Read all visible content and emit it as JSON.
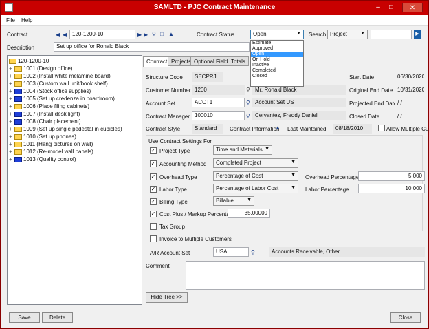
{
  "window": {
    "title": "SAMLTD - PJC Contract Maintenance"
  },
  "menu": {
    "file": "File",
    "help": "Help"
  },
  "header": {
    "contract_label": "Contract",
    "contract_value": "120-1200-10",
    "contract_status_label": "Contract Status",
    "contract_status_value": "Open",
    "search_label": "Search",
    "search_mode": "Project",
    "search_value": "",
    "description_label": "Description",
    "description_value": "Set up office for Ronald Black"
  },
  "status_options": [
    "Estimate",
    "Approved",
    "Open",
    "On Hold",
    "Inactive",
    "Completed",
    "Closed"
  ],
  "tree": {
    "root": "120-1200-10",
    "items": [
      {
        "label": "1001 (Design office)",
        "color": "yellow"
      },
      {
        "label": "1002 (Install white melamine board)",
        "color": "yellow"
      },
      {
        "label": "1003 (Custom wall unit/book shelf)",
        "color": "yellow"
      },
      {
        "label": "1004 (Stock office supplies)",
        "color": "blue"
      },
      {
        "label": "1005 (Set up credenza in boardroom)",
        "color": "blue"
      },
      {
        "label": "1006 (Place filing cabinets)",
        "color": "yellow"
      },
      {
        "label": "1007 (Install desk light)",
        "color": "blue"
      },
      {
        "label": "1008 (Chair placement)",
        "color": "blue"
      },
      {
        "label": "1009 (Set up single pedestal in cubicles)",
        "color": "yellow"
      },
      {
        "label": "1010 (Set up phones)",
        "color": "yellow"
      },
      {
        "label": "1011 (Hang pictures on wall)",
        "color": "yellow"
      },
      {
        "label": "1012 (Re-model wall panels)",
        "color": "yellow"
      },
      {
        "label": "1013 (Quality control)",
        "color": "blue"
      }
    ]
  },
  "tabs": [
    "Contract",
    "Projects",
    "Optional Fields",
    "Totals"
  ],
  "form": {
    "structure_code_label": "Structure Code",
    "structure_code_value": "SECPRJ",
    "customer_number_label": "Customer Number",
    "customer_number_value": "1200",
    "customer_name": "Mr. Ronald Black",
    "account_set_label": "Account Set",
    "account_set_value": "ACCT1",
    "account_set_desc": "Account Set US",
    "contract_manager_label": "Contract Manager",
    "contract_manager_value": "100010",
    "contract_manager_name": "Cervantez, Freddy Daniel",
    "contract_style_label": "Contract Style",
    "contract_style_value": "Standard",
    "contract_information_label": "Contract Information",
    "last_maintained_label": "Last Maintained",
    "last_maintained_value": "08/18/2010",
    "allow_multiple_label": "Allow Multiple Cus",
    "start_date_label": "Start Date",
    "start_date_value": "06/30/2020",
    "original_end_date_label": "Original End Date",
    "original_end_date_value": "10/31/2020",
    "projected_end_date_label": "Projected End Date",
    "projected_end_date_value": "/ /",
    "closed_date_label": "Closed Date",
    "closed_date_value": "/ /"
  },
  "settings": {
    "group_label": "Use Contract Settings For",
    "project_type_label": "Project Type",
    "project_type_value": "Time and Materials",
    "accounting_method_label": "Accounting Method",
    "accounting_method_value": "Completed Project",
    "overhead_type_label": "Overhead Type",
    "overhead_type_value": "Percentage of Cost",
    "overhead_percentage_label": "Overhead Percentage",
    "overhead_percentage_value": "5.000",
    "labor_type_label": "Labor Type",
    "labor_type_value": "Percentage of Labor Cost",
    "labor_percentage_label": "Labor Percentage",
    "labor_percentage_value": "10.000",
    "billing_type_label": "Billing Type",
    "billing_type_value": "Billable",
    "cost_plus_label": "Cost Plus / Markup Percentage",
    "cost_plus_value": "35.00000",
    "tax_group_label": "Tax Group",
    "invoice_multiple_label": "Invoice to Multiple Customers"
  },
  "ar": {
    "label": "A/R Account Set",
    "value": "USA",
    "desc": "Accounts Receivable, Other"
  },
  "comment_label": "Comment",
  "hide_tree_label": "Hide Tree >>",
  "footer": {
    "save": "Save",
    "delete": "Delete",
    "close": "Close"
  },
  "colors": {
    "titlebar": "#c80000",
    "selection": "#3399ff"
  }
}
